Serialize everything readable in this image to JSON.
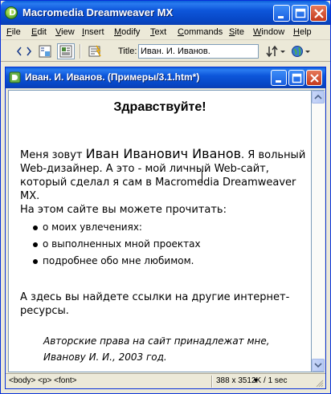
{
  "app": {
    "title": "Macromedia Dreamweaver MX",
    "icon_letter": "D"
  },
  "menu": [
    {
      "label": "File",
      "u": "F",
      "rest": "ile"
    },
    {
      "label": "Edit",
      "u": "E",
      "rest": "dit"
    },
    {
      "label": "View",
      "u": "V",
      "rest": "iew"
    },
    {
      "label": "Insert",
      "u": "I",
      "rest": "nsert"
    },
    {
      "label": "Modify",
      "u": "M",
      "rest": "odify"
    },
    {
      "label": "Text",
      "u": "T",
      "rest": "ext"
    },
    {
      "label": "Commands",
      "u": "C",
      "rest": "ommands"
    },
    {
      "label": "Site",
      "u": "S",
      "rest": "ite"
    },
    {
      "label": "Window",
      "u": "W",
      "rest": "indow"
    },
    {
      "label": "Help",
      "u": "H",
      "rest": "elp"
    }
  ],
  "toolbar": {
    "title_label": "Title:",
    "title_value": "Иван. И. Иванов."
  },
  "document": {
    "window_title": "Иван. И. Иванов. (Примеры/3.1.htm*)",
    "heading": "Здравствуйте!",
    "intro_before_name": "Меня зовут ",
    "name": "Иван Иванович Иванов",
    "intro_after_name": ". Я вольный Web-дизайнер. А это - мой личный Web-сайт, который сделал я сам в Macromedia Dreamweaver MX.",
    "intro_line2": "На этом сайте вы можете прочитать:",
    "list_items": [
      "о моих увлечениях:",
      "о выполненных мной проектах",
      "подробнее обо мне любимом."
    ],
    "links_text": "А здесь вы найдете ссылки на другие интернет-ресурсы.",
    "copyright_line1": "Авторские права на сайт принадлежат мне,",
    "copyright_line2": "Иванову И. И., 2003 год."
  },
  "status": {
    "tags": "<body> <p> <font>",
    "dimensions": "388 x 351",
    "dims_arrow": "▾",
    "size": "2K / 1 sec"
  },
  "colors": {
    "titlebar": "#0a5fd8",
    "chrome": "#ece9d8",
    "close_button": "#c4391c"
  }
}
